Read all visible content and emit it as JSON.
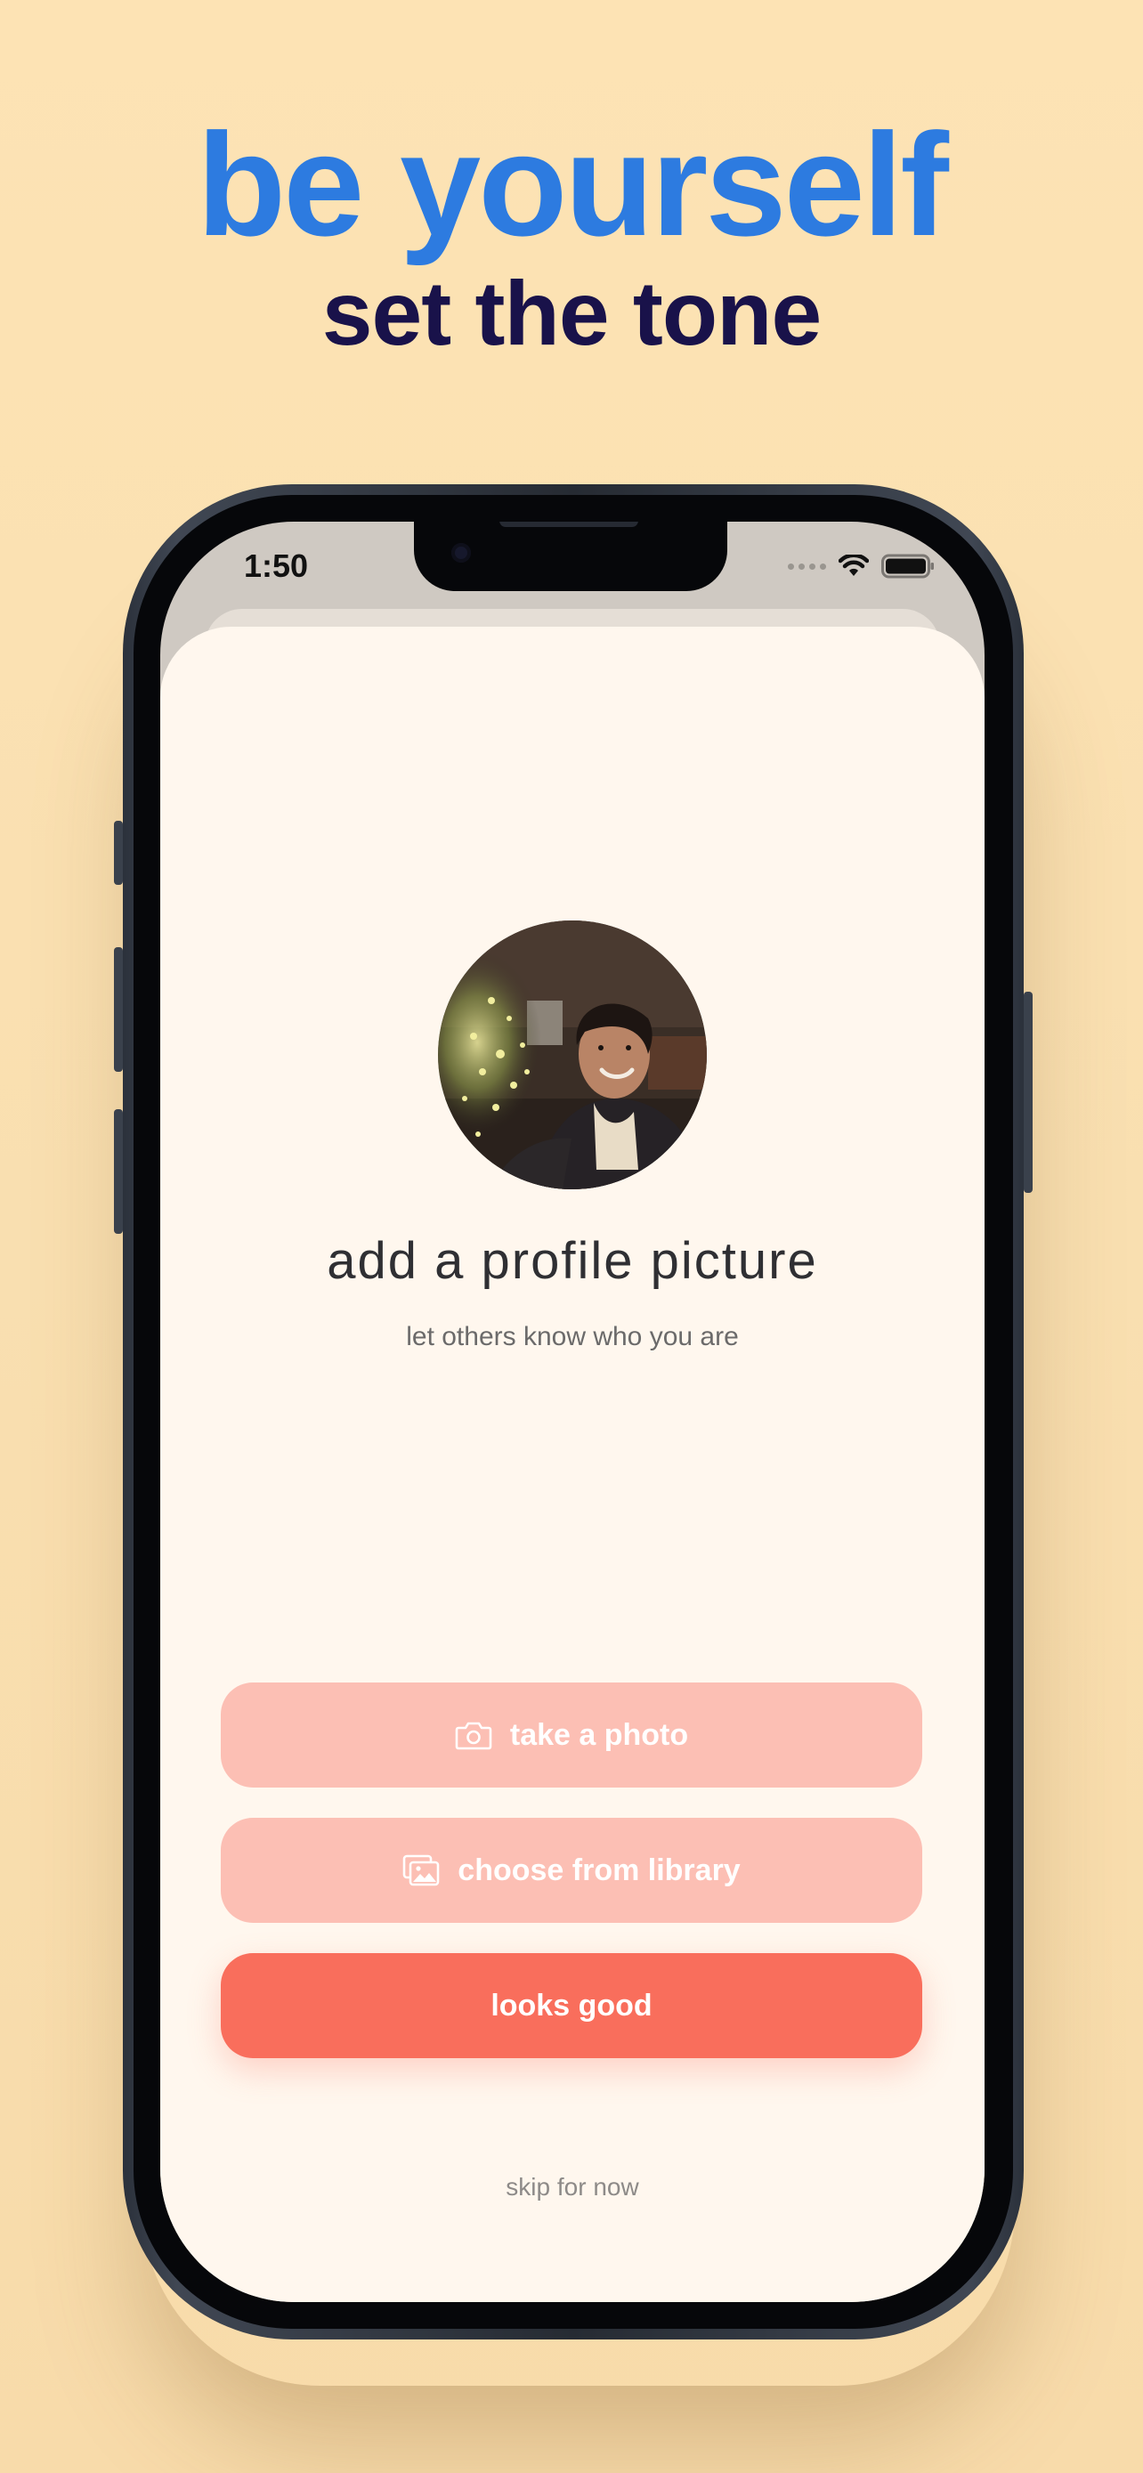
{
  "promo": {
    "headline": "be yourself",
    "subheadline": "set the tone"
  },
  "status_bar": {
    "time": "1:50",
    "icons": [
      "signal-dots-icon",
      "wifi-icon",
      "battery-icon"
    ]
  },
  "screen": {
    "avatar_icon": "profile-photo",
    "title": "add a profile picture",
    "subtitle": "let others know who you are",
    "buttons": {
      "take_photo": {
        "label": "take a photo",
        "icon": "camera-icon"
      },
      "choose_library": {
        "label": "choose from library",
        "icon": "photo-library-icon"
      },
      "confirm": {
        "label": "looks good"
      }
    },
    "skip_label": "skip for now"
  },
  "colors": {
    "background": "#fde3b4",
    "headline": "#2d7be0",
    "subheadline": "#19124a",
    "sheet": "#fff7ee",
    "button_light": "#fcbfb4",
    "button_primary": "#f96e5c"
  }
}
